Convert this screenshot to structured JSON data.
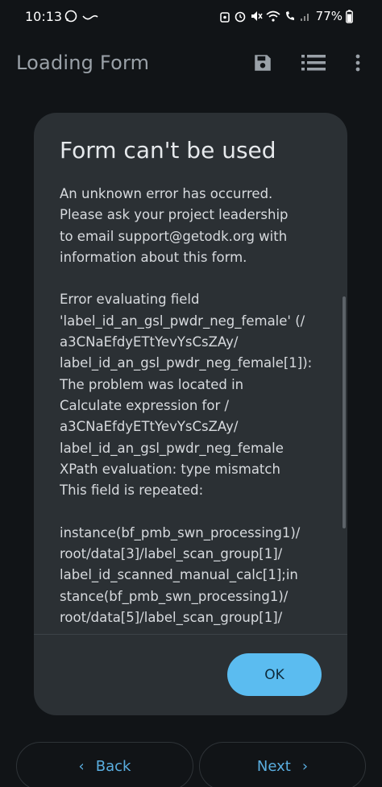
{
  "status_bar": {
    "time": "10:13",
    "battery": "77%"
  },
  "app_bar": {
    "title": "Loading Form",
    "icons": [
      "save-icon",
      "list-icon",
      "more-vert-icon"
    ]
  },
  "dialog": {
    "title": "Form can't be used",
    "body": "An unknown error has occurred.\nPlease ask your project leadership\nto email support@getodk.org with\ninformation about this form.\n\nError evaluating field\n'label_id_an_gsl_pwdr_neg_female' (/\na3CNaEfdyETtYevYsCsZAy/\nlabel_id_an_gsl_pwdr_neg_female[1]):\nThe problem was located in\nCalculate expression for /\na3CNaEfdyETtYevYsCsZAy/\nlabel_id_an_gsl_pwdr_neg_female\nXPath evaluation: type mismatch\nThis field is repeated:\n\ninstance(bf_pmb_swn_processing1)/\nroot/data[3]/label_scan_group[1]/\nlabel_id_scanned_manual_calc[1];in\nstance(bf_pmb_swn_processing1)/\nroot/data[5]/label_scan_group[1]/",
    "ok_label": "OK"
  },
  "navigation": {
    "back_label": "Back",
    "next_label": "Next"
  },
  "colors": {
    "background": "#111417",
    "dialog": "#2b3034",
    "accent": "#5bbcf0",
    "nav_text": "#5aaee0"
  }
}
